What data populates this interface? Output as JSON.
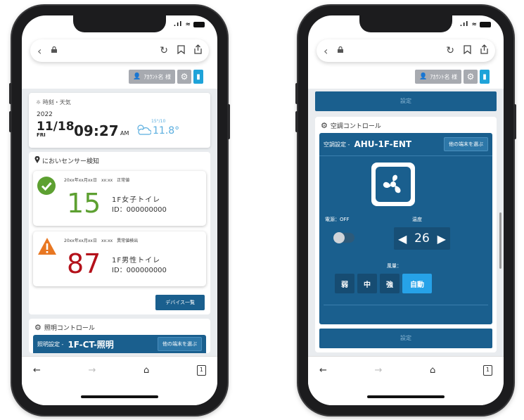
{
  "left": {
    "browser": {
      "back_icon": "‹",
      "lock_icon": "🔒",
      "reload_icon": "↻",
      "bookmark_icon": "⊓",
      "share_icon": "⇪"
    },
    "topnav": {
      "user_label": "ｱｶｳﾝﾄ名 様"
    },
    "weather": {
      "title": "時刻・天気",
      "year": "2022",
      "date": "11/18",
      "dow": "FRI",
      "time": "09:27",
      "ampm": "AM",
      "hi": "15°/10",
      "temp": "11.8°"
    },
    "sensor": {
      "title": "においセンサー検知",
      "items": [
        {
          "meta": "20xx年xx月xx日　xx:xx　正常値",
          "value": "15",
          "place": "1F女子トイレ",
          "id": "ID：000000000",
          "status": "ok",
          "color": "#5da031"
        },
        {
          "meta": "20xx年xx月xx日　xx:xx　異常値検出",
          "value": "87",
          "place": "1F男性トイレ",
          "id": "ID：000000000",
          "status": "warn",
          "color": "#b4111a"
        }
      ],
      "list_button": "デバイス一覧"
    },
    "lighting": {
      "title": "照明コントロール",
      "label": "照明設定 -",
      "name": "1F-CT-照明",
      "select_button": "他の端末を選ぶ"
    },
    "bottombar": {
      "back": "←",
      "forward": "→",
      "home": "⌂",
      "tabs": "1"
    }
  },
  "right": {
    "browser": {
      "back_icon": "‹",
      "lock_icon": "🔒",
      "reload_icon": "↻",
      "bookmark_icon": "⊓",
      "share_icon": "⇪"
    },
    "topnav": {
      "user_label": "ｱｶｳﾝﾄ名 様"
    },
    "top_set_button": "設定",
    "ac": {
      "title": "空調コントロール",
      "label": "空調設定 -",
      "name": "AHU-1F-ENT",
      "select_button": "他の端末を選ぶ",
      "power_label": "電源：OFF",
      "temp_label": "温度",
      "temp_value": "26",
      "wind_label": "風量：",
      "wind_options": [
        "弱",
        "中",
        "強",
        "自動"
      ],
      "wind_selected": "自動",
      "set_button": "設定"
    },
    "bottombar": {
      "back": "←",
      "forward": "→",
      "home": "⌂",
      "tabs": "1"
    }
  },
  "colors": {
    "accent": "#1a5f8e",
    "active": "#26a2e8",
    "ok": "#5da031",
    "warn": "#e87722"
  }
}
